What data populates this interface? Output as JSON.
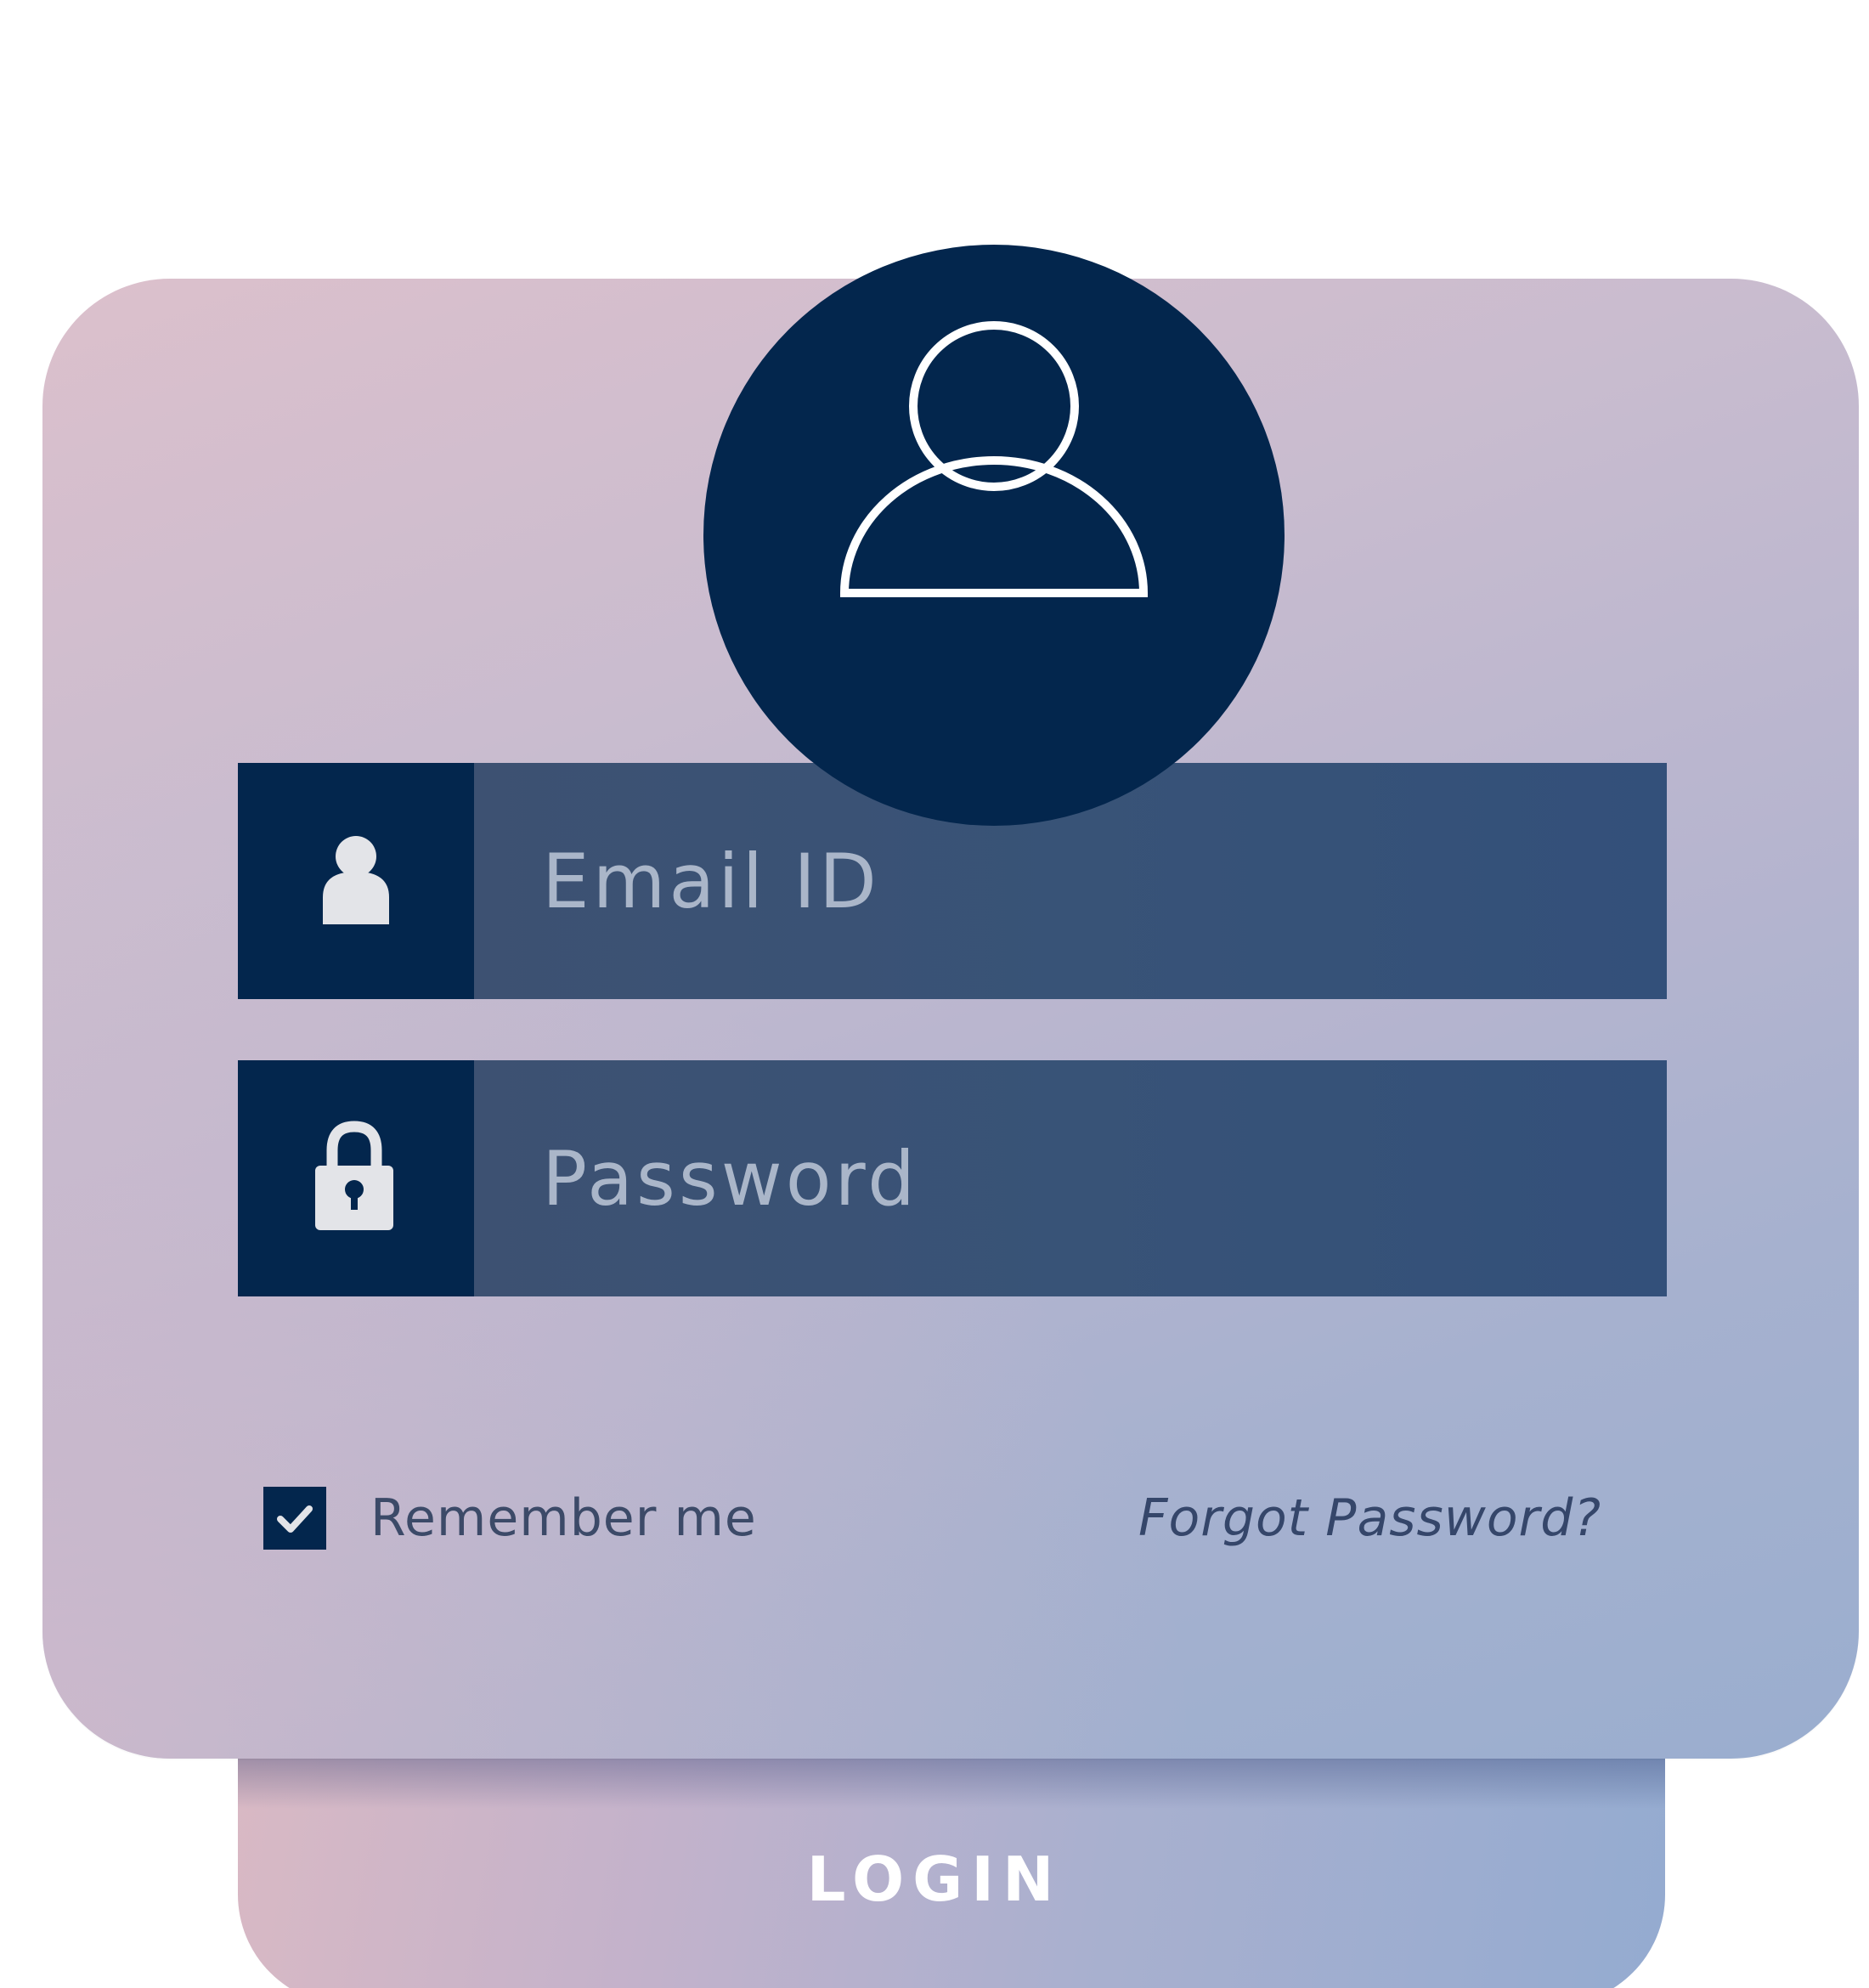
{
  "form": {
    "email_placeholder": "Email ID",
    "password_placeholder": "Password",
    "remember_label": "Remember me",
    "remember_checked": true,
    "forgot_link": "Forgot Password?",
    "login_label": "LOGIN"
  },
  "icons": {
    "avatar": "user-outline-icon",
    "email": "user-icon",
    "password": "lock-icon",
    "checkbox": "check-icon"
  },
  "colors": {
    "navy": "#03264d",
    "field": "#385377",
    "placeholder": "#aab6c9",
    "text": "#3c4a68",
    "white": "#ffffff"
  }
}
